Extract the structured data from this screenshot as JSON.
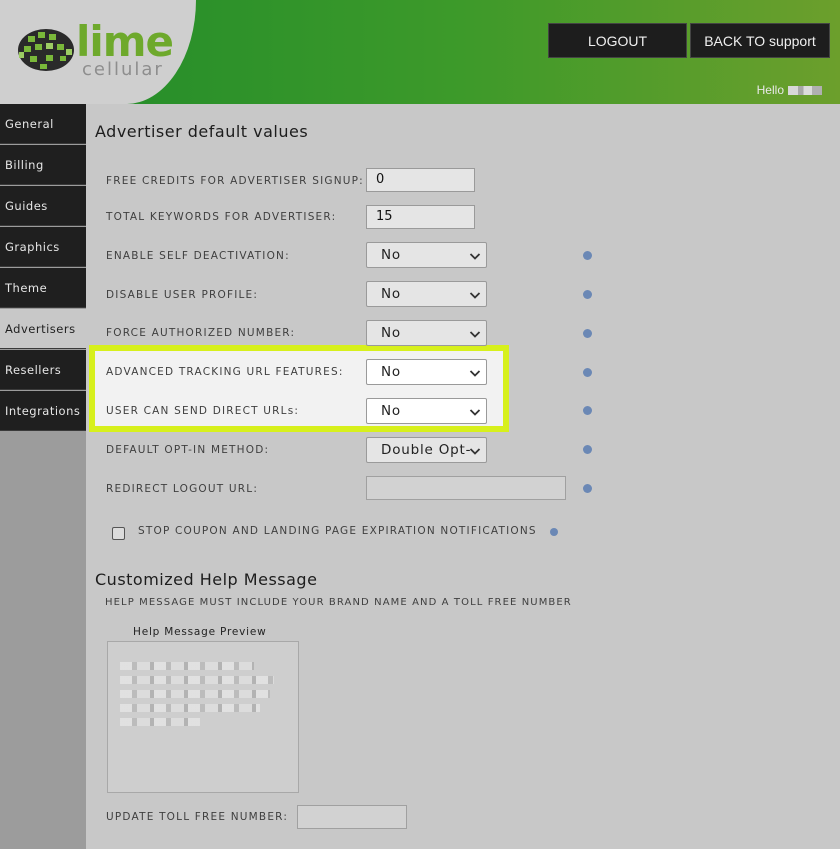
{
  "brand": {
    "wordmark": "lime",
    "subtitle": "cellular"
  },
  "header": {
    "logout_label": "LOGOUT",
    "back_label": "BACK TO support",
    "hello_text": "Hello"
  },
  "sidebar": {
    "items": [
      {
        "label": "General"
      },
      {
        "label": "Billing"
      },
      {
        "label": "Guides"
      },
      {
        "label": "Graphics"
      },
      {
        "label": "Theme"
      },
      {
        "label": "Advertisers"
      },
      {
        "label": "Resellers"
      },
      {
        "label": "Integrations"
      }
    ],
    "active": "Advertisers"
  },
  "main": {
    "section_title": "Advertiser default values",
    "fields": [
      {
        "label": "FREE CREDITS FOR ADVERTISER SIGNUP:",
        "type": "text",
        "value": "0"
      },
      {
        "label": "TOTAL KEYWORDS FOR ADVERTISER:",
        "type": "text",
        "value": "15"
      },
      {
        "label": "ENABLE SELF DEACTIVATION:",
        "type": "select",
        "value": "No"
      },
      {
        "label": "DISABLE USER PROFILE:",
        "type": "select",
        "value": "No"
      },
      {
        "label": "FORCE AUTHORIZED NUMBER:",
        "type": "select",
        "value": "No"
      },
      {
        "label": "ADVANCED TRACKING URL FEATURES:",
        "type": "select",
        "value": "No"
      },
      {
        "label": "USER CAN SEND DIRECT URLs:",
        "type": "select",
        "value": "No"
      },
      {
        "label": "DEFAULT OPT-IN METHOD:",
        "type": "select",
        "value": "Double Opt-"
      },
      {
        "label": "REDIRECT LOGOUT URL:",
        "type": "text",
        "value": ""
      }
    ],
    "checkbox_label": "STOP COUPON AND LANDING PAGE EXPIRATION NOTIFICATIONS",
    "help_title": "Customized Help Message",
    "help_subtitle": "HELP MESSAGE MUST INCLUDE YOUR BRAND NAME AND A TOLL FREE NUMBER",
    "preview_label": "Help Message Preview",
    "toll_label": "UPDATE TOLL FREE NUMBER:"
  },
  "colors": {
    "highlight": "#d7f01c",
    "info_dot": "#6b88b5",
    "header_green": "#1f8a2a"
  }
}
